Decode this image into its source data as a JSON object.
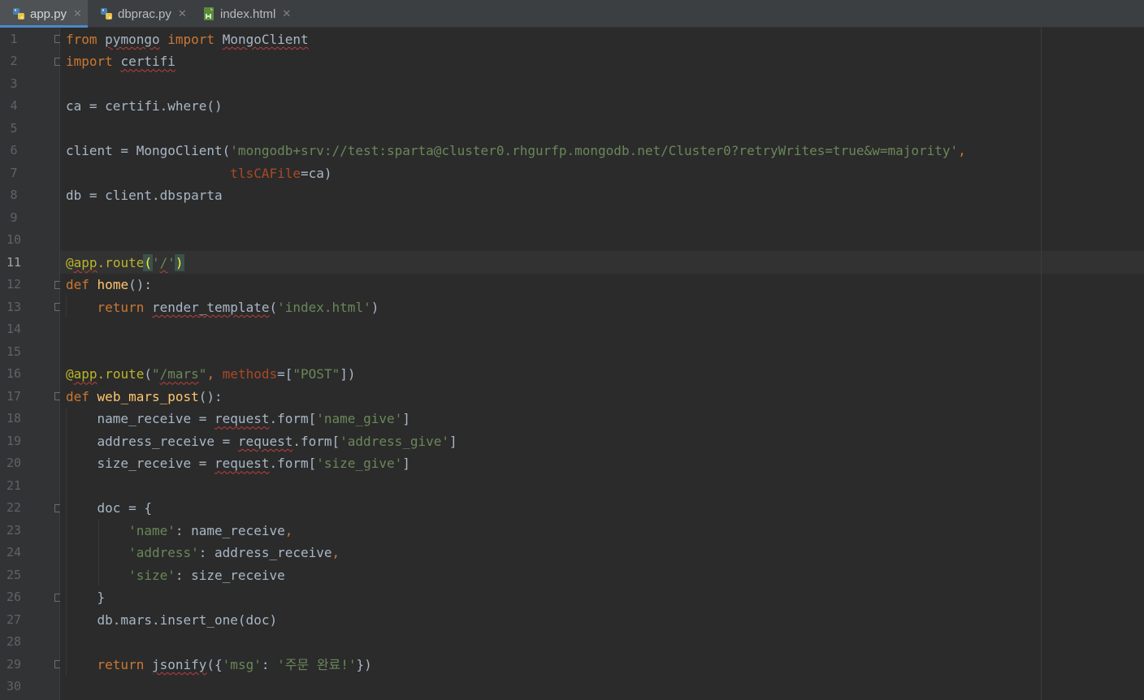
{
  "tabs": [
    {
      "label": "app.py",
      "icon": "python-file-icon",
      "active": true
    },
    {
      "label": "dbprac.py",
      "icon": "python-file-icon",
      "active": false
    },
    {
      "label": "index.html",
      "icon": "html-file-icon",
      "active": false
    }
  ],
  "close_glyph": "✕",
  "current_line": 11,
  "colors": {
    "background": "#2b2b2b",
    "keyword": "#cc7832",
    "string": "#6a8759",
    "function": "#ffc66d",
    "decorator": "#bbb529",
    "tab_accent": "#4a88c7"
  },
  "line_numbers": [
    "1",
    "2",
    "3",
    "4",
    "5",
    "6",
    "7",
    "8",
    "9",
    "10",
    "11",
    "12",
    "13",
    "14",
    "15",
    "16",
    "17",
    "18",
    "19",
    "20",
    "21",
    "22",
    "23",
    "24",
    "25",
    "26",
    "27",
    "28",
    "29",
    "30"
  ],
  "code": {
    "l1": {
      "t1": "from",
      "t2": " ",
      "t3": "pymongo",
      "t4": " ",
      "t5": "import",
      "t6": " ",
      "t7": "MongoClient"
    },
    "l2": {
      "t1": "import",
      "t2": " ",
      "t3": "certifi"
    },
    "l4": {
      "t1": "ca = certifi.where()"
    },
    "l6": {
      "t1": "client = MongoClient(",
      "t2": "'mongodb+srv://test:sparta@cluster0.rhgurfp.mongodb.net/Cluster0?retryWrites=true&w=majority'",
      "t3": ","
    },
    "l7": {
      "t1": "                     ",
      "t2": "tlsCAFile",
      "t3": "=ca)"
    },
    "l8": {
      "t1": "db = client.dbsparta"
    },
    "l11": {
      "t1": "@",
      "t2": "app",
      "t3": ".route",
      "t4": "(",
      "t5": "'",
      "t6": "/",
      "t7": "'",
      "t8": ")"
    },
    "l12": {
      "t1": "def",
      "t2": " ",
      "t3": "home",
      "t4": "():"
    },
    "l13": {
      "t1": "    ",
      "t2": "return",
      "t3": " ",
      "t4": "render_template",
      "t5": "(",
      "t6": "'index.html'",
      "t7": ")"
    },
    "l16": {
      "t1": "@",
      "t2": "app",
      "t3": ".route",
      "t4": "(",
      "t5": "\"",
      "t6": "/mars",
      "t7": "\"",
      "t8": ", ",
      "t9": "methods",
      "t10": "=[",
      "t11": "\"POST\"",
      "t12": "])"
    },
    "l17": {
      "t1": "def",
      "t2": " ",
      "t3": "web_mars_post",
      "t4": "():"
    },
    "l18": {
      "t1": "    name_receive = ",
      "t2": "request",
      "t3": ".form[",
      "t4": "'name_give'",
      "t5": "]"
    },
    "l19": {
      "t1": "    address_receive = ",
      "t2": "request",
      "t3": ".form[",
      "t4": "'address_give'",
      "t5": "]"
    },
    "l20": {
      "t1": "    size_receive = ",
      "t2": "request",
      "t3": ".form[",
      "t4": "'size_give'",
      "t5": "]"
    },
    "l22": {
      "t1": "    doc = {"
    },
    "l23": {
      "t1": "        ",
      "t2": "'name'",
      "t3": ": name_receive",
      "t4": ","
    },
    "l24": {
      "t1": "        ",
      "t2": "'address'",
      "t3": ": address_receive",
      "t4": ","
    },
    "l25": {
      "t1": "        ",
      "t2": "'size'",
      "t3": ": size_receive"
    },
    "l26": {
      "t1": "    }"
    },
    "l27": {
      "t1": "    db.mars.insert_one(doc)"
    },
    "l29": {
      "t1": "    ",
      "t2": "return",
      "t3": " ",
      "t4": "jsonify",
      "t5": "({",
      "t6": "'msg'",
      "t7": ": ",
      "t8": "'주문 완료!'",
      "t9": "})"
    }
  }
}
